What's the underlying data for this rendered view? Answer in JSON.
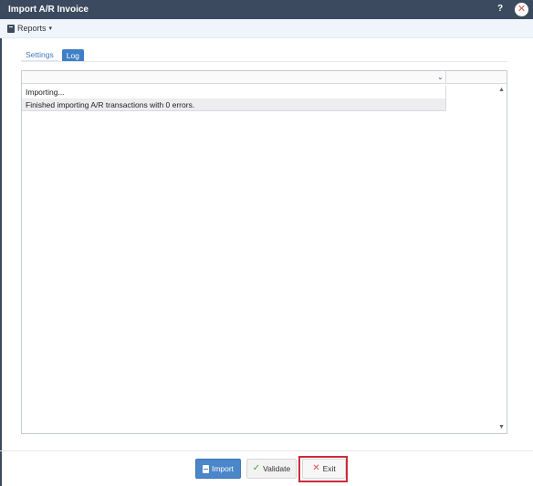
{
  "window": {
    "title": "Import A/R Invoice",
    "help_label": "?",
    "close_label": "✕"
  },
  "toolbar": {
    "reports_label": "Reports",
    "reports_caret": "▾"
  },
  "tabs": [
    {
      "label": "Settings",
      "active": false
    },
    {
      "label": "Log",
      "active": true
    }
  ],
  "log": {
    "header_chevron": "⌄",
    "rows": [
      {
        "message": "Importing..."
      },
      {
        "message": "Finished importing A/R transactions with 0 errors."
      }
    ],
    "scroll_up": "▲",
    "scroll_down": "▼"
  },
  "footer": {
    "import_label": "Import",
    "validate_label": "Validate",
    "validate_icon": "✓",
    "exit_label": "Exit",
    "exit_icon": "✕"
  },
  "colors": {
    "title_bar": "#3b4a5e",
    "accent": "#4a86c8",
    "highlight": "#cc2b3b"
  }
}
